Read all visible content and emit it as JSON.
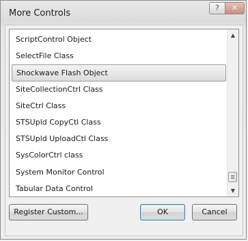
{
  "window": {
    "title": "More Controls",
    "help_glyph": "?",
    "close_glyph": "✕"
  },
  "list": {
    "items": [
      {
        "label": "ScriptControl Object",
        "selected": false
      },
      {
        "label": "SelectFile Class",
        "selected": false
      },
      {
        "label": "Shockwave Flash Object",
        "selected": true
      },
      {
        "label": "SiteCollectionCtrl Class",
        "selected": false
      },
      {
        "label": "SiteCtrl Class",
        "selected": false
      },
      {
        "label": "STSUpld CopyCtl Class",
        "selected": false
      },
      {
        "label": "STSUpld UploadCtl Class",
        "selected": false
      },
      {
        "label": "SysColorCtrl class",
        "selected": false
      },
      {
        "label": "System Monitor Control",
        "selected": false
      },
      {
        "label": "Tabular Data Control",
        "selected": false
      }
    ]
  },
  "scrollbar": {
    "up_glyph": "▲",
    "down_glyph": "▼"
  },
  "buttons": {
    "register": "Register Custom...",
    "ok": "OK",
    "cancel": "Cancel"
  }
}
